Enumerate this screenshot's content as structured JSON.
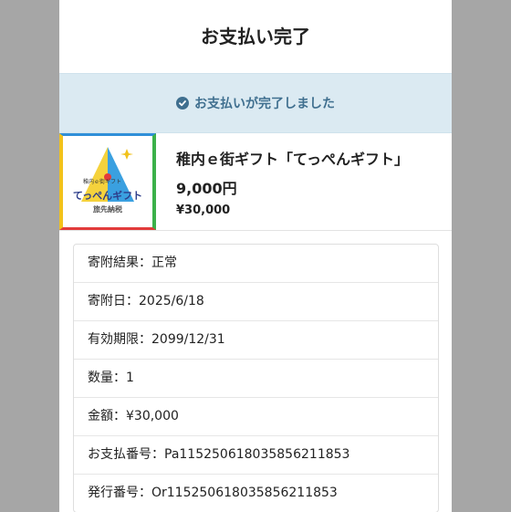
{
  "page": {
    "title": "お支払い完了"
  },
  "alert": {
    "message": "お支払いが完了しました",
    "icon": "check-circle-icon",
    "color": "#3f6f8f"
  },
  "product": {
    "name": "稚内ｅ街ギフト「てっぺんギフト」",
    "amount": "9,000円",
    "price": "¥30,000",
    "logo": {
      "top_text": "稚内ｅ街ギフト",
      "main_text": "てっぺんギフト",
      "sub_text": "旅先納税"
    }
  },
  "details": [
    {
      "label": "寄附結果：正常"
    },
    {
      "label": "寄附日：2025/6/18"
    },
    {
      "label": "有効期限：2099/12/31"
    },
    {
      "label": "数量：1"
    },
    {
      "label": "金額：¥30,000"
    },
    {
      "label": "お支払番号：Pa1152506180358562118​53"
    },
    {
      "label": "発行番号：Or115250618035856211853"
    }
  ]
}
